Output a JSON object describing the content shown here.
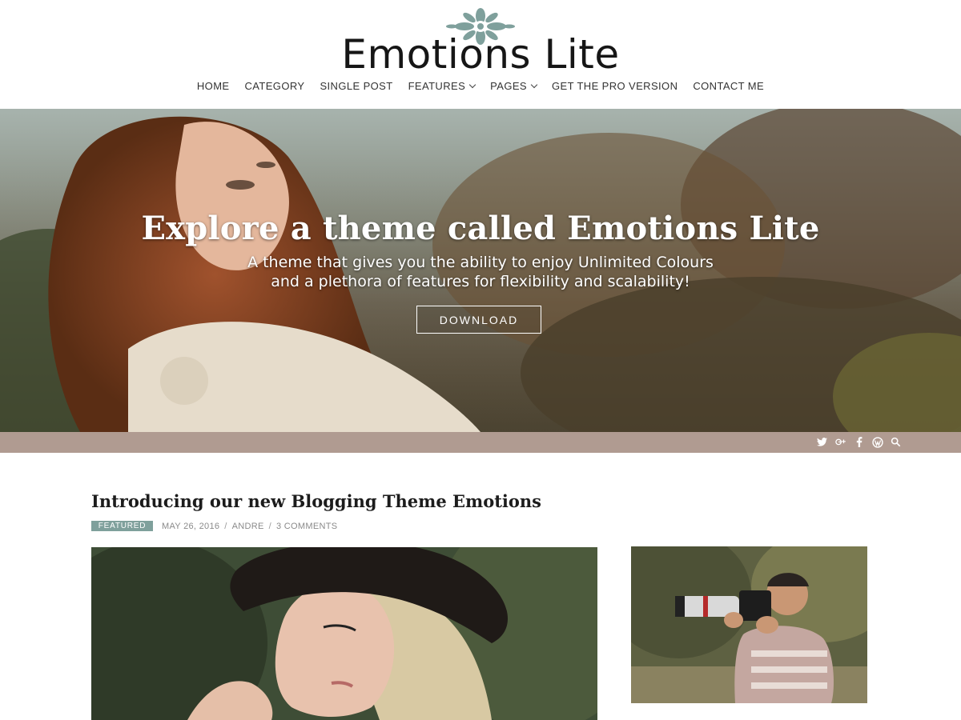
{
  "site": {
    "title": "Emotions Lite",
    "accent_color": "#7fa09c",
    "logo_icon": "flower-icon"
  },
  "nav": {
    "items": [
      {
        "label": "HOME",
        "has_dropdown": false
      },
      {
        "label": "CATEGORY",
        "has_dropdown": false
      },
      {
        "label": "SINGLE POST",
        "has_dropdown": false
      },
      {
        "label": "FEATURES",
        "has_dropdown": true
      },
      {
        "label": "PAGES",
        "has_dropdown": true
      },
      {
        "label": "GET THE PRO VERSION",
        "has_dropdown": false
      },
      {
        "label": "CONTACT ME",
        "has_dropdown": false
      }
    ]
  },
  "hero": {
    "title": "Explore a theme called Emotions Lite",
    "subtitle_line1": "A theme that gives you the ability to enjoy Unlimited Colours",
    "subtitle_line2": "and a plethora of features for flexibility and scalability!",
    "button_label": "DOWNLOAD"
  },
  "social_bar": {
    "color": "#b09b91",
    "icons": [
      "twitter-icon",
      "google-plus-icon",
      "facebook-icon",
      "wordpress-icon",
      "search-icon"
    ]
  },
  "post": {
    "title": "Introducing our new Blogging Theme Emotions",
    "badge": "FEATURED",
    "date": "MAY 26, 2016",
    "author": "ANDRE",
    "comments": "3 COMMENTS",
    "separator": "/"
  }
}
